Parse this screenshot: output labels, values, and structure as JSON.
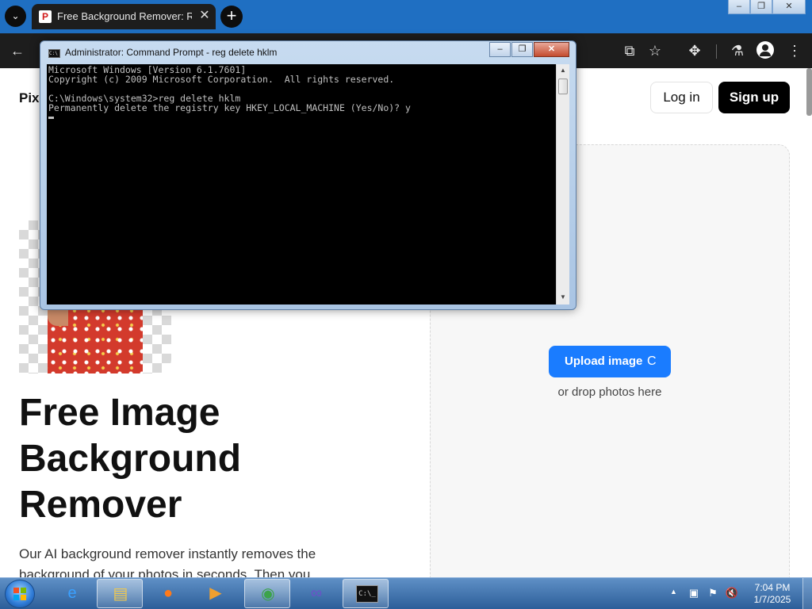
{
  "browser": {
    "tab_title": "Free Background Remover: Remove Bg from Image - Pixelcut",
    "tab_favicon": "P",
    "tab_menu_icon": "chevron-down-icon",
    "new_tab_icon": "plus-icon",
    "toolbar_icons": [
      "back-arrow-icon",
      "install-app-icon",
      "star-icon",
      "extensions-icon",
      "labs-flask-icon",
      "profile-icon",
      "kebab-menu-icon"
    ]
  },
  "window_controls": {
    "minimize": "–",
    "maximize": "❐",
    "close": "✕"
  },
  "page": {
    "brand": "Pix",
    "login_label": "Log in",
    "signup_label": "Sign up",
    "headline": [
      "Free Image",
      "Background",
      "Remover"
    ],
    "description": "Our AI background remover instantly removes the background of your photos in seconds. Then you",
    "upload_label": "Upload image",
    "upload_spinner": "C",
    "drop_hint": "or drop photos here"
  },
  "cmd_window": {
    "title": "Administrator:  Command Prompt - reg  delete hklm",
    "icon_text": "C:\\",
    "lines": [
      "Microsoft Windows [Version 6.1.7601]",
      "Copyright (c) 2009 Microsoft Corporation.  All rights reserved.",
      "",
      "C:\\Windows\\system32>reg delete hklm",
      "Permanently delete the registry key HKEY_LOCAL_MACHINE (Yes/No)? y"
    ]
  },
  "taskbar": {
    "items": [
      {
        "name": "internet-explorer-icon",
        "glyph": "e",
        "color": "#3aa0ff"
      },
      {
        "name": "file-explorer-icon",
        "glyph": "▤",
        "color": "#f2c94c"
      },
      {
        "name": "firefox-icon",
        "glyph": "●",
        "color": "#ff7a1a"
      },
      {
        "name": "media-player-icon",
        "glyph": "▶",
        "color": "#f0a030"
      },
      {
        "name": "chrome-icon",
        "glyph": "◉",
        "color": "#3ca34a"
      },
      {
        "name": "visual-studio-icon",
        "glyph": "∞",
        "color": "#6b52c8"
      },
      {
        "name": "command-prompt-icon",
        "glyph": "C:\\_",
        "color": "#cccccc"
      }
    ],
    "tray": {
      "time": "7:04 PM",
      "date": "1/7/2025"
    }
  },
  "colors": {
    "accent": "#1a7cff",
    "taskbar": "#2c5e99",
    "tabstrip": "#1f6fc2"
  }
}
